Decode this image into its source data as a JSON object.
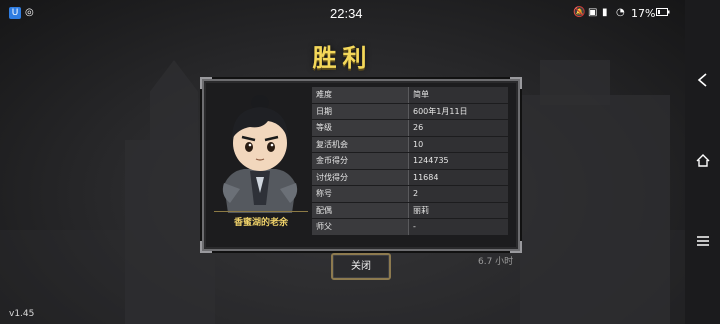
{
  "status_bar": {
    "time": "22:34",
    "battery": "17%",
    "icons": [
      "app-badge-icon",
      "notification-icon",
      "mute-icon",
      "hd-icon",
      "signal-icon",
      "wifi-icon",
      "battery-icon"
    ]
  },
  "result": {
    "title": "胜利",
    "character_name": "香蜜湖的老余",
    "stats": [
      {
        "label": "难度",
        "value": "简单"
      },
      {
        "label": "日期",
        "value": "600年1月11日"
      },
      {
        "label": "等级",
        "value": "26"
      },
      {
        "label": "复活机会",
        "value": "10"
      },
      {
        "label": "金币得分",
        "value": "1244735"
      },
      {
        "label": "讨伐得分",
        "value": "11684"
      },
      {
        "label": "称号",
        "value": "2"
      },
      {
        "label": "配偶",
        "value": "丽莉"
      },
      {
        "label": "师父",
        "value": "-"
      }
    ],
    "close_button": "关闭",
    "playtime": "6.7 小时"
  },
  "footer": {
    "version": "v1.45"
  },
  "navbar": {
    "back": "back-icon",
    "home": "home-icon",
    "menu": "menu-icon"
  },
  "colors": {
    "title": "#f4d85a",
    "name": "#f1d36a",
    "panel_border": "#6d6d70",
    "button_border": "#8d7a4f"
  }
}
